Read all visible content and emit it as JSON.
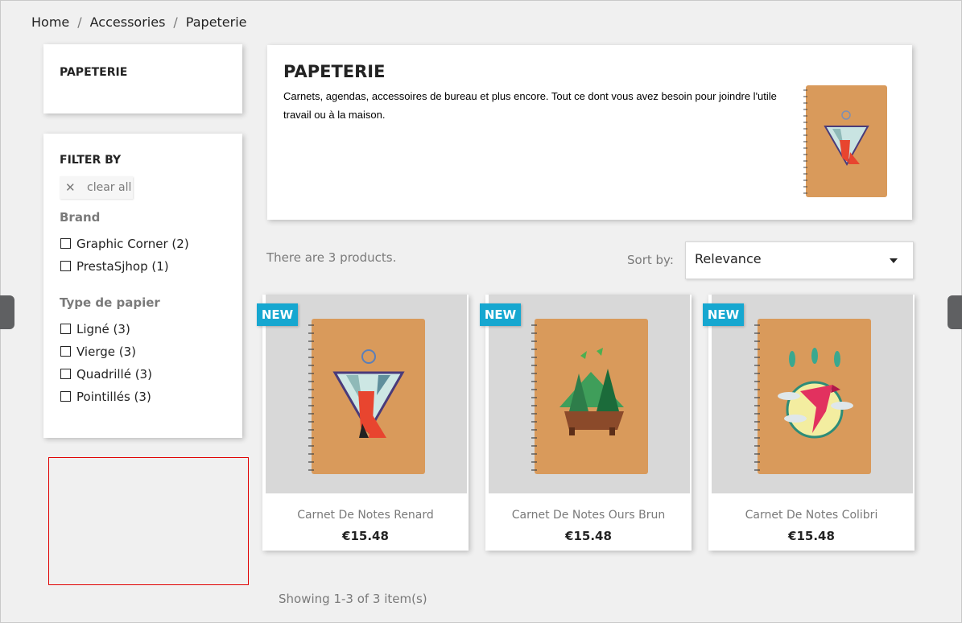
{
  "breadcrumb": [
    "Home",
    "Accessories",
    "Papeterie"
  ],
  "sidebar": {
    "category_title": "PAPETERIE",
    "filter_by": "FILTER BY",
    "clear_all": "clear all",
    "facets": [
      {
        "title": "Brand",
        "options": [
          {
            "label": "Graphic Corner (2)",
            "checked": false
          },
          {
            "label": "PrestaSjhop (1)",
            "checked": false
          }
        ]
      },
      {
        "title": "Type de papier",
        "options": [
          {
            "label": "Ligné (3)",
            "checked": false
          },
          {
            "label": "Vierge (3)",
            "checked": false
          },
          {
            "label": "Quadrillé (3)",
            "checked": false
          },
          {
            "label": "Pointillés (3)",
            "checked": false
          }
        ]
      }
    ]
  },
  "category": {
    "title": "PAPETERIE",
    "description": "Carnets, agendas, accessoires de bureau et plus encore. Tout ce dont vous avez besoin pour joindre l'utile travail ou à la maison.",
    "image_icon": "notebook-fox-image"
  },
  "listing": {
    "count_text": "There are 3 products.",
    "sort_label": "Sort by:",
    "sort_value": "Relevance",
    "showing": "Showing 1-3 of 3 item(s)"
  },
  "products": [
    {
      "name": "Carnet De Notes Renard",
      "price": "€15.48",
      "flag": "NEW",
      "image_icon": "notebook-fox-image"
    },
    {
      "name": "Carnet De Notes Ours Brun",
      "price": "€15.48",
      "flag": "NEW",
      "image_icon": "notebook-bear-image"
    },
    {
      "name": "Carnet De Notes Colibri",
      "price": "€15.48",
      "flag": "NEW",
      "image_icon": "notebook-hummingbird-image"
    }
  ],
  "colors": {
    "new_flag": "#16a7d0",
    "notebook_cover": "#d99a5b",
    "highlight_box": "#e00000"
  }
}
